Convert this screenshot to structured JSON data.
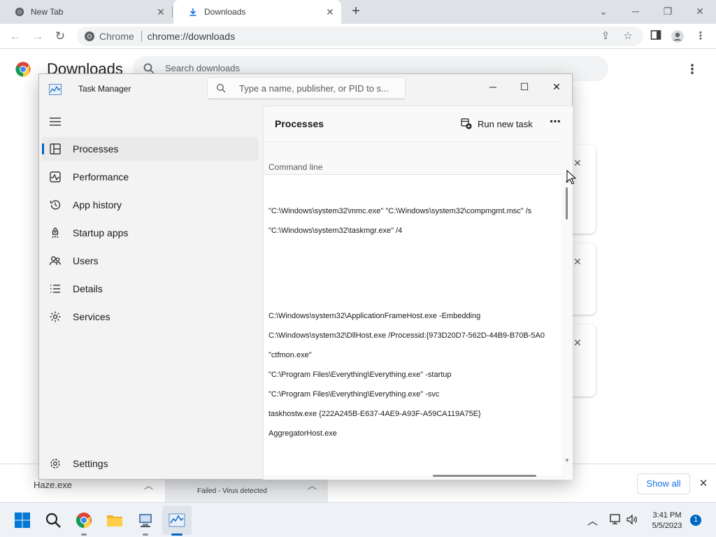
{
  "browser": {
    "tabs": [
      {
        "label": "New Tab",
        "icon": "chrome-icon"
      },
      {
        "label": "Downloads",
        "icon": "download-icon"
      }
    ],
    "omnibox": {
      "site": "Chrome",
      "url": "chrome://downloads"
    }
  },
  "downloads_page": {
    "title": "Downloads",
    "search_placeholder": "Search downloads"
  },
  "download_shelf": {
    "items": [
      {
        "name": "Haze.exe",
        "status": ""
      },
      {
        "name": "",
        "status": "Failed - Virus detected"
      }
    ],
    "show_all_label": "Show all"
  },
  "task_manager": {
    "title": "Task Manager",
    "search_placeholder": "Type a name, publisher, or PID to s...",
    "nav": [
      {
        "label": "Processes",
        "icon": "processes-icon",
        "active": true
      },
      {
        "label": "Performance",
        "icon": "performance-icon"
      },
      {
        "label": "App history",
        "icon": "app-history-icon"
      },
      {
        "label": "Startup apps",
        "icon": "startup-apps-icon"
      },
      {
        "label": "Users",
        "icon": "users-icon"
      },
      {
        "label": "Details",
        "icon": "details-icon"
      },
      {
        "label": "Services",
        "icon": "services-icon"
      }
    ],
    "settings_label": "Settings",
    "page_title": "Processes",
    "run_new_task_label": "Run new task",
    "column_header": "Command line",
    "rows": [
      "",
      "",
      "\"C:\\Windows\\system32\\mmc.exe\" \"C:\\Windows\\system32\\compmgmt.msc\" /s",
      "\"C:\\Windows\\system32\\taskmgr.exe\" /4",
      "",
      "",
      "",
      "C:\\Windows\\system32\\ApplicationFrameHost.exe -Embedding",
      "C:\\Windows\\system32\\DllHost.exe /Processid:{973D20D7-562D-44B9-B70B-5A0",
      "\"ctfmon.exe\"",
      "\"C:\\Program Files\\Everything\\Everything.exe\" -startup",
      "\"C:\\Program Files\\Everything\\Everything.exe\" -svc",
      "taskhostw.exe {222A245B-E637-4AE9-A93F-A59CA119A75E}",
      "AggregatorHost.exe"
    ]
  },
  "taskbar": {
    "time": "3:41 PM",
    "date": "5/5/2023",
    "notification_count": "1"
  },
  "colors": {
    "accent": "#0067c0",
    "chrome_link": "#1a73e8"
  }
}
